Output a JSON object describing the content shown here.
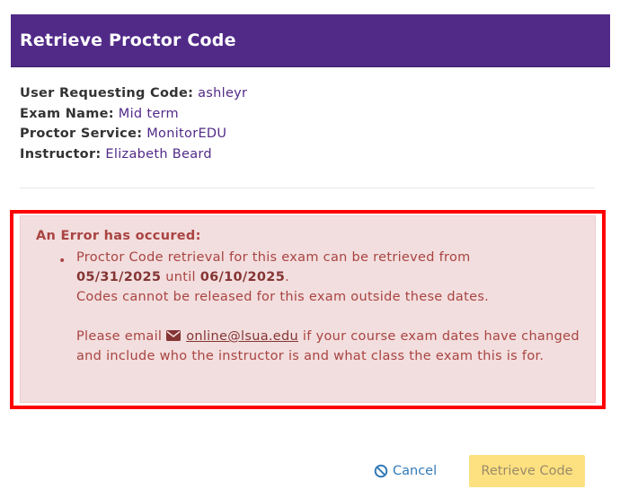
{
  "dialog": {
    "title": "Retrieve Proctor Code"
  },
  "info": {
    "user_label": "User Requesting Code:",
    "user_value": "ashleyr",
    "exam_label": "Exam Name:",
    "exam_value": "Mid term",
    "service_label": "Proctor Service:",
    "service_value": "MonitorEDU",
    "instructor_label": "Instructor:",
    "instructor_value": "Elizabeth Beard"
  },
  "error": {
    "heading": "An Error has occured:",
    "line1": "Proctor Code retrieval for this exam can be retrieved from",
    "start_date": "05/31/2025",
    "until_word": "until",
    "end_date": "06/10/2025",
    "period": ".",
    "line3": "Codes cannot be released for this exam outside these dates.",
    "please_email": "Please email",
    "email": "online@lsua.edu",
    "email_tail": "if your course exam dates have changed and include who the instructor is and what class the exam this is for.",
    "icon": "envelope-icon"
  },
  "buttons": {
    "cancel_label": "Cancel",
    "cancel_icon": "ban-icon",
    "retrieve_label": "Retrieve Code"
  },
  "colors": {
    "header": "#512a88",
    "error_bg": "#f2dede",
    "error_text": "#a94442",
    "highlight_border": "#ff0000",
    "link": "#337ab7",
    "retrieve_bg": "#fde180"
  }
}
